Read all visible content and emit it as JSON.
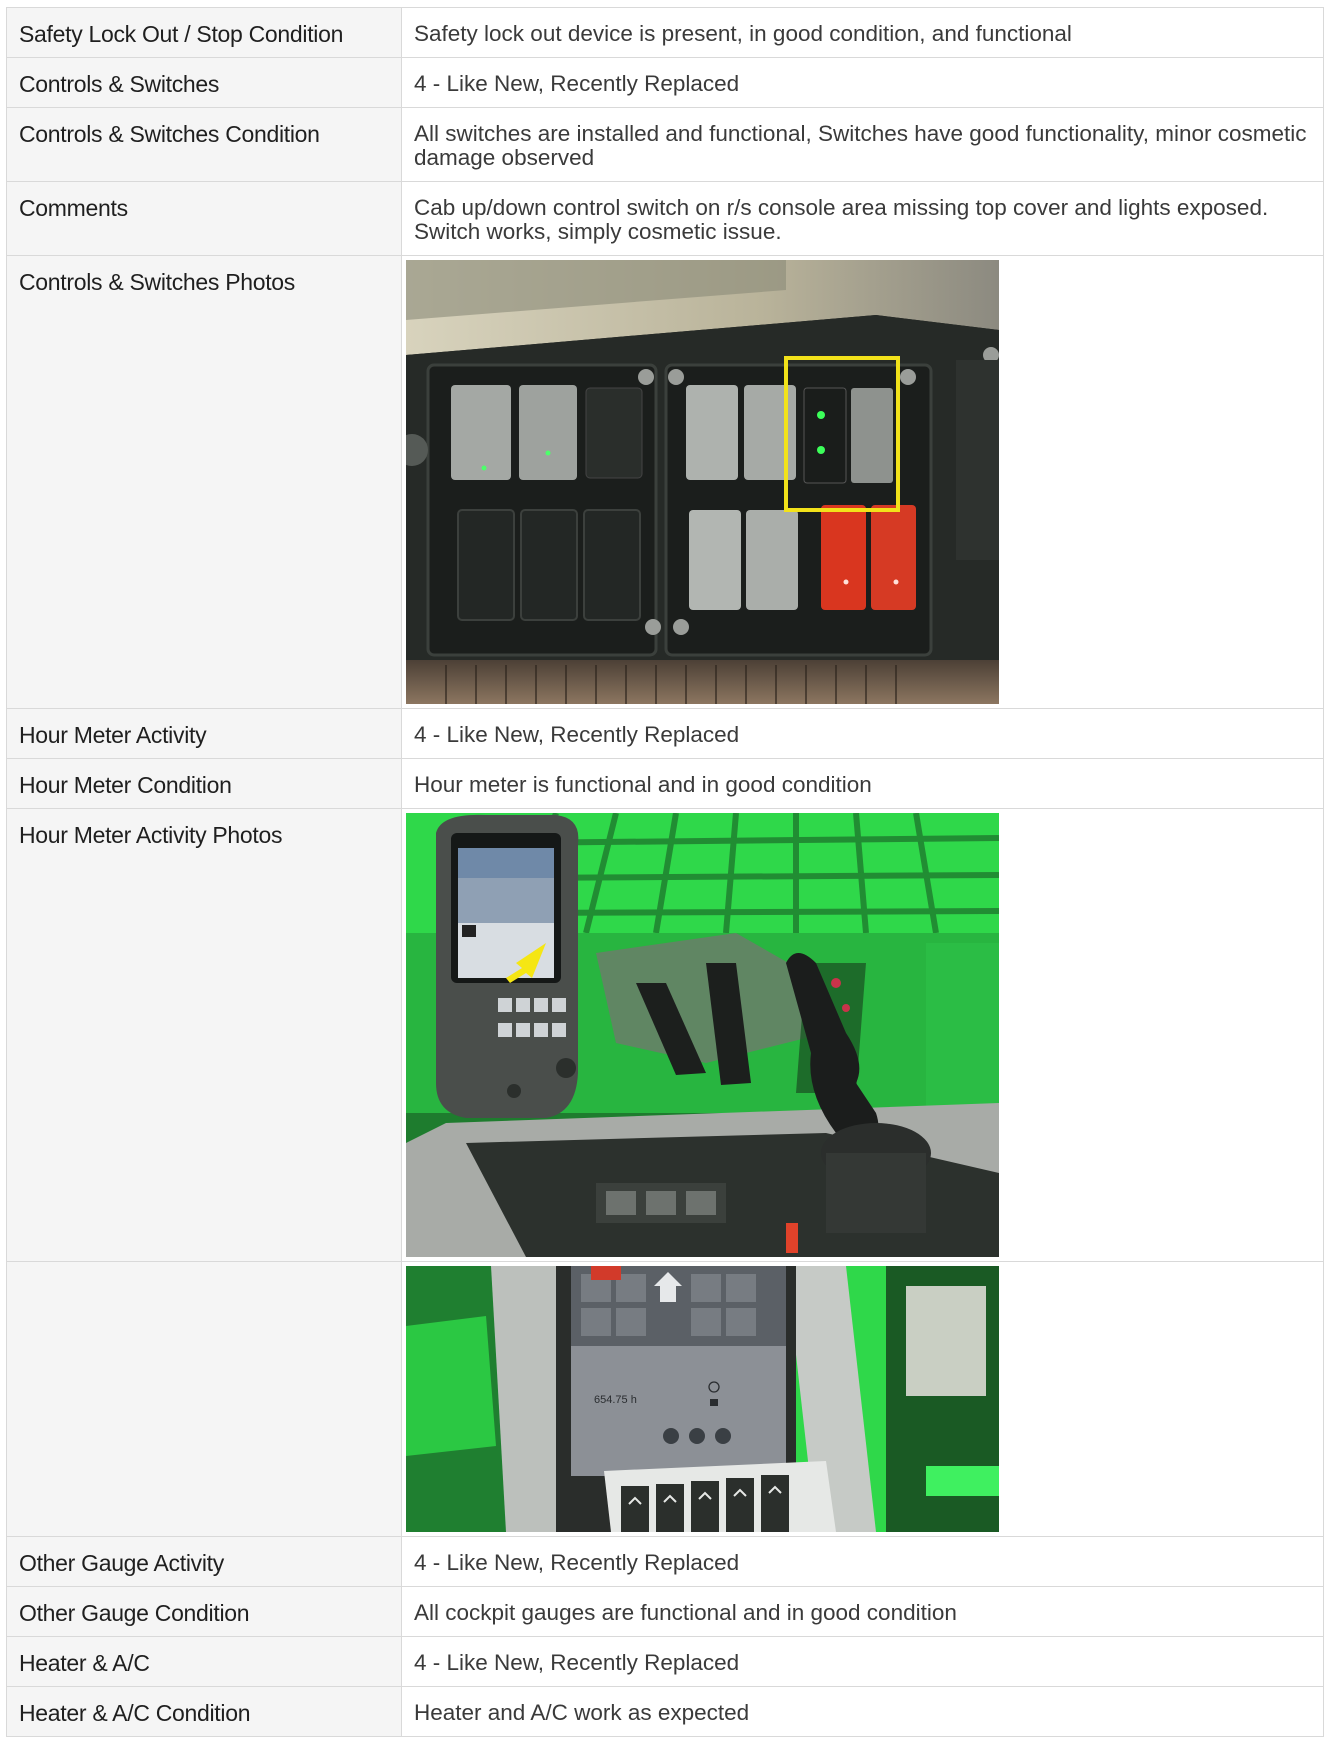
{
  "rows": [
    {
      "label": "Safety Lock Out / Stop Condition",
      "value": "Safety lock out device is present, in good condition, and functional"
    },
    {
      "label": "Controls & Switches",
      "value": "4 - Like New, Recently Replaced"
    },
    {
      "label": "Controls & Switches Condition",
      "value": "All switches are installed and functional, Switches have good functionality, minor cosmetic damage observed"
    },
    {
      "label": "Comments",
      "value": "Cab up/down control switch on r/s console area missing top cover and lights exposed. Switch works, simply cosmetic issue."
    },
    {
      "label": "Controls & Switches Photos"
    },
    {
      "label": "Hour Meter Activity",
      "value": "4 - Like New, Recently Replaced"
    },
    {
      "label": "Hour Meter Condition",
      "value": "Hour meter is functional and in good condition"
    },
    {
      "label": "Hour Meter Activity Photos"
    },
    {
      "label": ""
    },
    {
      "label": "Other Gauge Activity",
      "value": "4 - Like New, Recently Replaced"
    },
    {
      "label": "Other Gauge Condition",
      "value": "All cockpit gauges are functional and in good condition"
    },
    {
      "label": "Heater & A/C",
      "value": "4 - Like New, Recently Replaced"
    },
    {
      "label": "Heater & A/C Condition",
      "value": "Heater and A/C work as expected"
    }
  ],
  "photos": {
    "switches_panel": {
      "icons": [
        "rocker-switch-icon",
        "highlight-box-icon"
      ],
      "colors": {
        "panel": "#2b2f2c",
        "switch_gray": "#9a9d99",
        "switch_red": "#d9361f",
        "led_green": "#3cff5a",
        "highlight": "#f2e21a"
      }
    },
    "hour_meter_wide": {
      "icons": [
        "display-unit-icon",
        "joystick-icon",
        "arrow-icon"
      ],
      "colors": {
        "cab_green": "#22b33a",
        "arrow": "#f5e614"
      }
    },
    "hour_meter_close": {
      "readout": "654.75 h",
      "colors": {
        "cab_green": "#2fd84a",
        "screen": "#8c9096"
      }
    }
  }
}
